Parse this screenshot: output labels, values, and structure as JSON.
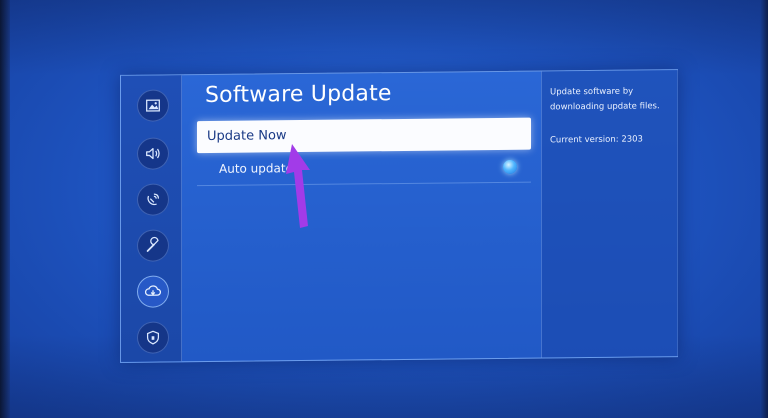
{
  "settings": {
    "title": "Software Update",
    "items": [
      {
        "label": "Update Now",
        "selected": true
      },
      {
        "label": "Auto update",
        "toggle_on": true
      }
    ]
  },
  "sidebar": {
    "icons": [
      {
        "name": "picture-icon"
      },
      {
        "name": "sound-icon"
      },
      {
        "name": "broadcasting-icon"
      },
      {
        "name": "general-icon"
      },
      {
        "name": "support-icon",
        "active": true
      },
      {
        "name": "privacy-icon"
      }
    ]
  },
  "info_panel": {
    "description": "Update software by downloading update files.",
    "version": "Current version: 2303"
  },
  "colors": {
    "accent": "#2a67d6",
    "selected_bg": "#fbfcff",
    "cursor": "#a23be8"
  }
}
